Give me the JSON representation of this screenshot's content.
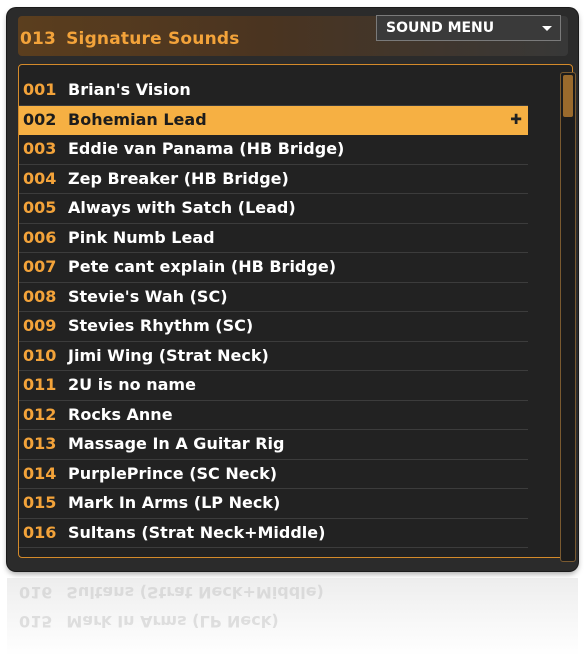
{
  "header": {
    "number": "013",
    "title": "Signature Sounds",
    "menu_label": "SOUND MENU"
  },
  "list": [
    {
      "num": "001",
      "name": "Brian's Vision"
    },
    {
      "num": "002",
      "name": "Bohemian Lead"
    },
    {
      "num": "003",
      "name": "Eddie van Panama (HB Bridge)"
    },
    {
      "num": "004",
      "name": "Zep Breaker (HB Bridge)"
    },
    {
      "num": "005",
      "name": "Always with Satch (Lead)"
    },
    {
      "num": "006",
      "name": "Pink Numb Lead"
    },
    {
      "num": "007",
      "name": "Pete cant explain (HB Bridge)"
    },
    {
      "num": "008",
      "name": "Stevie's Wah (SC)"
    },
    {
      "num": "009",
      "name": "Stevies Rhythm (SC)"
    },
    {
      "num": "010",
      "name": "Jimi Wing (Strat Neck)"
    },
    {
      "num": "011",
      "name": "2U is no name"
    },
    {
      "num": "012",
      "name": "Rocks Anne"
    },
    {
      "num": "013",
      "name": "Massage In A Guitar Rig"
    },
    {
      "num": "014",
      "name": "PurplePrince (SC Neck)"
    },
    {
      "num": "015",
      "name": "Mark In Arms  (LP Neck)"
    },
    {
      "num": "016",
      "name": "Sultans (Strat Neck+Middle)"
    }
  ],
  "selected_index": 1,
  "colors": {
    "accent": "#f3a33a",
    "selected_bg": "#f6b043",
    "panel_bg": "#2b2b2b"
  },
  "icons": {
    "menu_caret": "chevron-down-icon",
    "drag_handle": "move-icon"
  }
}
